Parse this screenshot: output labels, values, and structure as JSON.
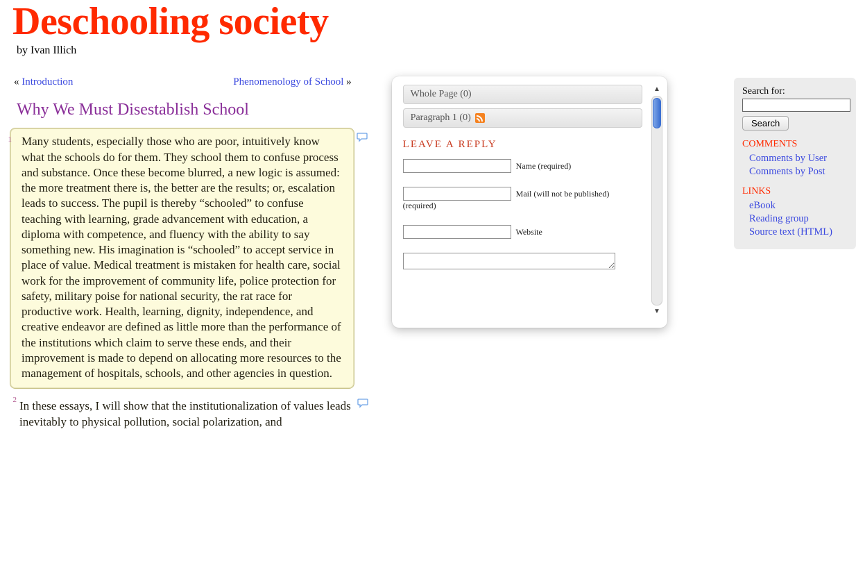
{
  "header": {
    "title": "Deschooling society",
    "byline": "by Ivan Illich"
  },
  "nav": {
    "prev_symbol": "«",
    "prev": "Introduction",
    "next": "Phenomenology of School",
    "next_symbol": "»"
  },
  "article": {
    "title": "Why We Must Disestablish School",
    "paragraphs": [
      {
        "num": "1",
        "selected": true,
        "text": "Many students, especially those who are poor, intuitively know what the schools do for them. They school them to confuse process and substance. Once these become blurred, a new logic is assumed: the more treatment there is, the better are the results; or, escalation leads to success. The pupil is thereby “schooled” to confuse teaching with learning, grade advancement with education, a diploma with competence, and fluency with the ability to say something new. His imagination is “schooled” to accept service in place of value. Medical treatment is mistaken for health care, social work for the improvement of community life, police protection for safety, military poise for national security, the rat race for productive work. Health, learning, dignity, independence, and creative endeavor are defined as little more than the performance of the institutions which claim to serve these ends, and their improvement is made to depend on allocating more resources to the management of hospitals, schools, and other agencies in question."
      },
      {
        "num": "2",
        "selected": false,
        "text": "In these essays, I will show that the institutionalization of values leads inevitably to physical pollution, social polarization, and"
      }
    ]
  },
  "panel": {
    "bars": [
      {
        "label": "Whole Page (0)",
        "rss": false
      },
      {
        "label": "Paragraph 1 (0)",
        "rss": true
      }
    ],
    "reply_title": "LEAVE A REPLY",
    "fields": {
      "name_label": "Name (required)",
      "mail_label": "Mail (will not be published) (required)",
      "website_label": "Website"
    }
  },
  "sidebar": {
    "search_label": "Search for:",
    "search_button": "Search",
    "sections": [
      {
        "title": "COMMENTS",
        "links": [
          "Comments by User",
          "Comments by Post"
        ]
      },
      {
        "title": "LINKS",
        "links": [
          "eBook",
          "Reading group",
          "Source text (HTML)"
        ]
      }
    ]
  }
}
